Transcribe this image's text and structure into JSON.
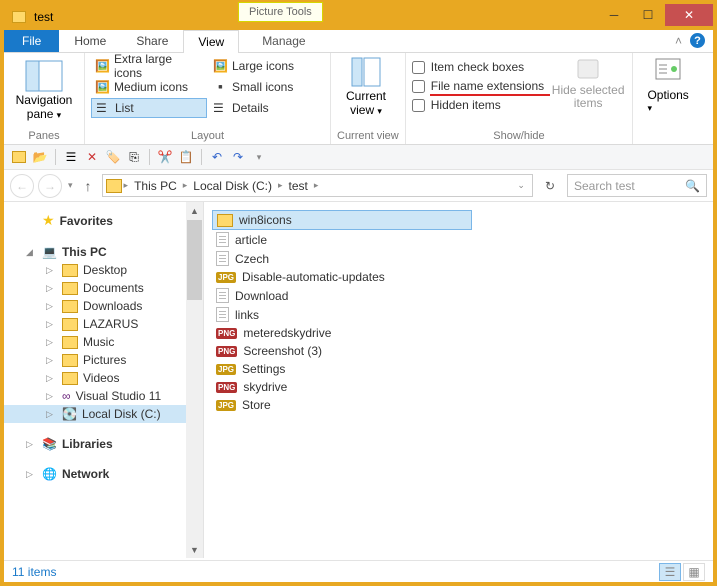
{
  "title": "test",
  "picture_tools_label": "Picture Tools",
  "tabs": {
    "file": "File",
    "home": "Home",
    "share": "Share",
    "view": "View",
    "manage": "Manage"
  },
  "ribbon": {
    "panes": "Panes",
    "nav_pane": "Navigation",
    "nav_pane2": "pane",
    "layout": "Layout",
    "layout_items": {
      "xl": "Extra large icons",
      "lg": "Large icons",
      "md": "Medium icons",
      "sm": "Small icons",
      "list": "List",
      "details": "Details"
    },
    "current_view": "Current",
    "current_view2": "view",
    "current_view_group": "Current view",
    "showhide": "Show/hide",
    "item_check": "Item check boxes",
    "file_ext": "File name extensions",
    "hidden": "Hidden items",
    "hide_selected": "Hide selected",
    "hide_selected2": "items",
    "options": "Options"
  },
  "breadcrumbs": [
    "This PC",
    "Local Disk (C:)",
    "test"
  ],
  "search_placeholder": "Search test",
  "sidebar": {
    "favorites": "Favorites",
    "this_pc": "This PC",
    "items": [
      "Desktop",
      "Documents",
      "Downloads",
      "LAZARUS",
      "Music",
      "Pictures",
      "Videos",
      "Visual Studio 11",
      "Local Disk (C:)"
    ],
    "libraries": "Libraries",
    "network": "Network"
  },
  "files": [
    {
      "name": "win8icons",
      "type": "folder",
      "selected": true
    },
    {
      "name": "article",
      "type": "doc"
    },
    {
      "name": "Czech",
      "type": "doc"
    },
    {
      "name": "Disable-automatic-updates",
      "type": "jpg"
    },
    {
      "name": "Download",
      "type": "doc"
    },
    {
      "name": "links",
      "type": "doc"
    },
    {
      "name": "meteredskydrive",
      "type": "png"
    },
    {
      "name": "Screenshot (3)",
      "type": "png"
    },
    {
      "name": "Settings",
      "type": "jpg"
    },
    {
      "name": "skydrive",
      "type": "png"
    },
    {
      "name": "Store",
      "type": "jpg"
    }
  ],
  "status_text": "11 items"
}
